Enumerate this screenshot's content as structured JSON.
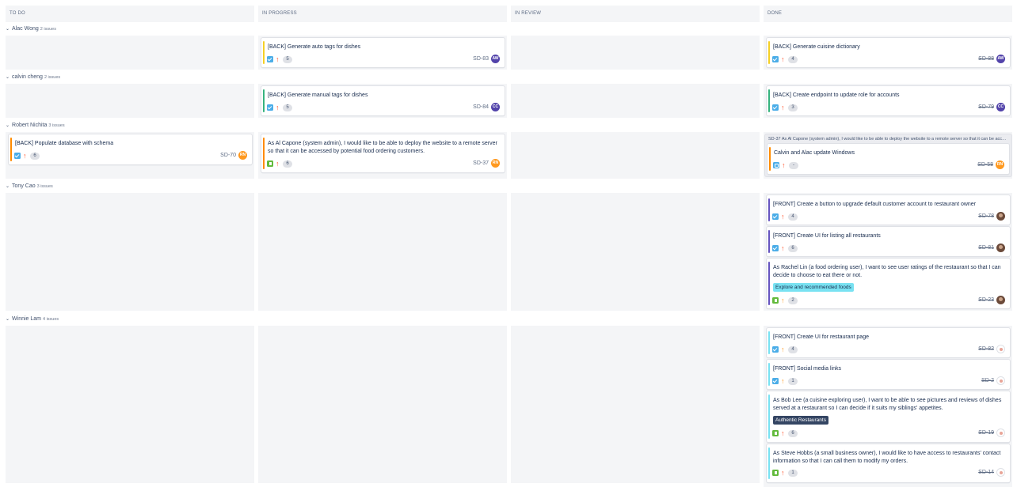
{
  "columns": [
    {
      "label": "TO DO"
    },
    {
      "label": "IN PROGRESS"
    },
    {
      "label": "IN REVIEW"
    },
    {
      "label": "DONE"
    }
  ],
  "swimlanes": [
    {
      "name": "Alac Wong",
      "count": "2 issues"
    },
    {
      "name": "calvin cheng",
      "count": "2 issues"
    },
    {
      "name": "Robert Nichita",
      "count": "3 issues"
    },
    {
      "name": "Tony Cao",
      "count": "3 issues"
    },
    {
      "name": "Winnie Lam",
      "count": "4 issues"
    }
  ],
  "cards": {
    "aw_inprog": {
      "summary": "[BACK] Generate auto tags for dishes",
      "points": "5",
      "key": "SD-83",
      "avatar": "AW"
    },
    "aw_done": {
      "summary": "[BACK] Generate cuisine dictionary",
      "points": "4",
      "key": "SD-88",
      "avatar": "AW"
    },
    "cc_inprog": {
      "summary": "[BACK] Generate manual tags for dishes",
      "points": "5",
      "key": "SD-84",
      "avatar": "CC"
    },
    "cc_done": {
      "summary": "[BACK] Create endpoint to update role for accounts",
      "points": "3",
      "key": "SD-79",
      "avatar": "CC"
    },
    "rn_todo": {
      "summary": "[BACK] Populate database with schema",
      "points": "6",
      "key": "SD-70",
      "avatar": "RN"
    },
    "rn_inprog": {
      "summary": "As Al Capone (system admin), I would like to be able to deploy the website to a remote server so that it can be accessed by potential food ordering customers.",
      "points": "6",
      "key": "SD-37",
      "avatar": "RN"
    },
    "rn_done_parent": {
      "title": "SD-37 As Al Capone (system admin), I would like to be able to deploy the website to a remote server so that it can be accessed by potential food ordering customers."
    },
    "rn_done": {
      "summary": "Calvin and Alac update Windows",
      "points": "-",
      "key": "SD-58",
      "avatar": "RN"
    },
    "tc_done_1": {
      "summary": "[FRONT] Create a button to upgrade default customer account to restaurant owner",
      "points": "4",
      "key": "SD-78"
    },
    "tc_done_2": {
      "summary": "[FRONT] Create UI for listing all restaurants",
      "points": "6",
      "key": "SD-81"
    },
    "tc_done_3": {
      "summary": "As Rachel Lin (a food ordering user), I want to see user ratings of the restaurant so that I can decide to choose to eat there or not.",
      "epic": "Explore and recommended foods",
      "points": "2",
      "key": "SD-23"
    },
    "wl_done_1": {
      "summary": "[FRONT] Create UI for restaurant page",
      "points": "4",
      "key": "SD-82"
    },
    "wl_done_2": {
      "summary": "[FRONT] Social media links",
      "points": "1",
      "key": "SD-2"
    },
    "wl_done_3": {
      "summary": "As Bob Lee (a cuisine exploring user), I want to be able to see pictures and reviews of dishes served at a restaurant so I can decide if it suits my siblings' appetites.",
      "epic": "Authentic Restaurants",
      "points": "6",
      "key": "SD-19"
    },
    "wl_done_4": {
      "summary": "As Steve Hobbs (a small business owner), I would like to have access to restaurants' contact information so that I can call them to modify my orders.",
      "points": "1",
      "key": "SD-14"
    }
  },
  "colors": {
    "epic_yellow": "#f5d026",
    "epic_green": "#36b37e",
    "epic_orange": "#ff8b00",
    "epic_purple": "#6554c0",
    "epic_lightblue": "#79e2f2",
    "epic_label_teal": "#79e2f2",
    "epic_label_dark": "#344563"
  },
  "icons": {
    "task": "task-icon",
    "story": "story-icon",
    "subtask": "subtask-icon",
    "priority": "priority-high-icon",
    "collapse": "chevron-down-icon"
  }
}
